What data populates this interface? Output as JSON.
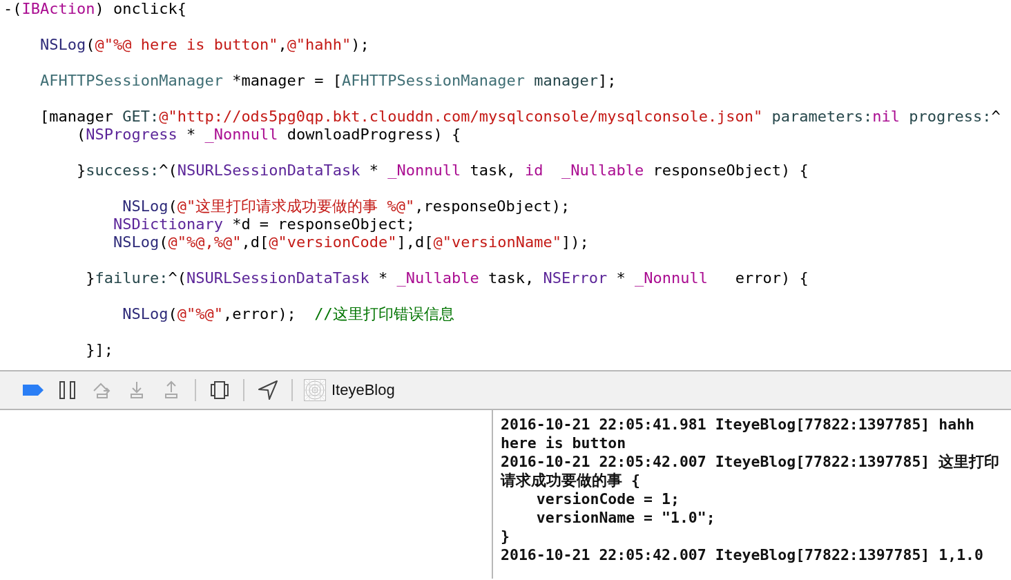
{
  "editor": {
    "lines": [
      {
        "kind": "code",
        "tokens": [
          {
            "kind": "plain",
            "text": "-("
          },
          {
            "kind": "keyword",
            "text": "IBAction"
          },
          {
            "kind": "plain",
            "text": ") onclick{"
          }
        ]
      },
      {
        "kind": "blank"
      },
      {
        "kind": "code",
        "tokens": [
          {
            "kind": "function",
            "text": "    NSLog"
          },
          {
            "kind": "plain",
            "text": "("
          },
          {
            "kind": "string",
            "text": "@\"%@ here is button\""
          },
          {
            "kind": "plain",
            "text": ","
          },
          {
            "kind": "string",
            "text": "@\"hahh\""
          },
          {
            "kind": "plain",
            "text": ");"
          }
        ]
      },
      {
        "kind": "blank"
      },
      {
        "kind": "code",
        "tokens": [
          {
            "kind": "project",
            "text": "    AFHTTPSessionManager"
          },
          {
            "kind": "plain",
            "text": " *manager = ["
          },
          {
            "kind": "project",
            "text": "AFHTTPSessionManager"
          },
          {
            "kind": "method",
            "text": " manager"
          },
          {
            "kind": "plain",
            "text": "];"
          }
        ]
      },
      {
        "kind": "blank"
      },
      {
        "kind": "code",
        "tokens": [
          {
            "kind": "plain",
            "text": "    [manager "
          },
          {
            "kind": "method",
            "text": "GET:"
          },
          {
            "kind": "string",
            "text": "@\"http://ods5pg0qp.bkt.clouddn.com/mysqlconsole/mysqlconsole.json\""
          },
          {
            "kind": "method",
            "text": " parameters:"
          },
          {
            "kind": "keyword",
            "text": "nil"
          },
          {
            "kind": "method",
            "text": " progress:"
          },
          {
            "kind": "plain",
            "text": "^"
          }
        ]
      },
      {
        "kind": "code",
        "tokens": [
          {
            "kind": "plain",
            "text": "        ("
          },
          {
            "kind": "type",
            "text": "NSProgress"
          },
          {
            "kind": "plain",
            "text": " * "
          },
          {
            "kind": "keyword",
            "text": "_Nonnull"
          },
          {
            "kind": "plain",
            "text": " downloadProgress) {"
          }
        ]
      },
      {
        "kind": "blank"
      },
      {
        "kind": "code",
        "tokens": [
          {
            "kind": "plain",
            "text": "        }"
          },
          {
            "kind": "method",
            "text": "success:"
          },
          {
            "kind": "plain",
            "text": "^("
          },
          {
            "kind": "type",
            "text": "NSURLSessionDataTask"
          },
          {
            "kind": "plain",
            "text": " * "
          },
          {
            "kind": "keyword",
            "text": "_Nonnull"
          },
          {
            "kind": "plain",
            "text": " task, "
          },
          {
            "kind": "keyword",
            "text": "id"
          },
          {
            "kind": "keyword",
            "text": "  _Nullable"
          },
          {
            "kind": "plain",
            "text": " responseObject) {"
          }
        ]
      },
      {
        "kind": "blank"
      },
      {
        "kind": "code",
        "tokens": [
          {
            "kind": "function",
            "text": "             NSLog"
          },
          {
            "kind": "plain",
            "text": "("
          },
          {
            "kind": "string",
            "text": "@\"这里打印请求成功要做的事 %@\""
          },
          {
            "kind": "plain",
            "text": ",responseObject);"
          }
        ]
      },
      {
        "kind": "code",
        "tokens": [
          {
            "kind": "type",
            "text": "            NSDictionary"
          },
          {
            "kind": "plain",
            "text": " *d = responseObject;"
          }
        ]
      },
      {
        "kind": "code",
        "tokens": [
          {
            "kind": "function",
            "text": "            NSLog"
          },
          {
            "kind": "plain",
            "text": "("
          },
          {
            "kind": "string",
            "text": "@\"%@,%@\""
          },
          {
            "kind": "plain",
            "text": ",d["
          },
          {
            "kind": "string",
            "text": "@\"versionCode\""
          },
          {
            "kind": "plain",
            "text": "],d["
          },
          {
            "kind": "string",
            "text": "@\"versionName\""
          },
          {
            "kind": "plain",
            "text": "]);"
          }
        ]
      },
      {
        "kind": "blank"
      },
      {
        "kind": "code",
        "tokens": [
          {
            "kind": "plain",
            "text": "         }"
          },
          {
            "kind": "method",
            "text": "failure:"
          },
          {
            "kind": "plain",
            "text": "^("
          },
          {
            "kind": "type",
            "text": "NSURLSessionDataTask"
          },
          {
            "kind": "plain",
            "text": " * "
          },
          {
            "kind": "keyword",
            "text": "_Nullable"
          },
          {
            "kind": "plain",
            "text": " task, "
          },
          {
            "kind": "type",
            "text": "NSError"
          },
          {
            "kind": "plain",
            "text": " * "
          },
          {
            "kind": "keyword",
            "text": "_Nonnull"
          },
          {
            "kind": "plain",
            "text": "   error) {"
          }
        ]
      },
      {
        "kind": "blank"
      },
      {
        "kind": "code",
        "tokens": [
          {
            "kind": "function",
            "text": "             NSLog"
          },
          {
            "kind": "plain",
            "text": "("
          },
          {
            "kind": "string",
            "text": "@\"%@\""
          },
          {
            "kind": "plain",
            "text": ",error);  "
          },
          {
            "kind": "comment",
            "text": "//这里打印错误信息"
          }
        ]
      },
      {
        "kind": "blank"
      },
      {
        "kind": "code",
        "tokens": [
          {
            "kind": "plain",
            "text": "         }];"
          }
        ]
      }
    ]
  },
  "debug_bar": {
    "items": [
      {
        "kind": "breakpoints",
        "disabled": false
      },
      {
        "kind": "pause",
        "disabled": false
      },
      {
        "kind": "step-over",
        "disabled": true
      },
      {
        "kind": "step-into",
        "disabled": true
      },
      {
        "kind": "step-out",
        "disabled": true
      },
      {
        "kind": "separator"
      },
      {
        "kind": "view-debugger",
        "disabled": false
      },
      {
        "kind": "separator"
      },
      {
        "kind": "location",
        "disabled": false
      },
      {
        "kind": "separator"
      }
    ],
    "target": "IteyeBlog"
  },
  "console": {
    "lines": [
      "2016-10-21 22:05:41.981 IteyeBlog[77822:1397785] hahh",
      "here is button",
      "2016-10-21 22:05:42.007 IteyeBlog[77822:1397785] 这里打印",
      "请求成功要做的事 {",
      "    versionCode = 1;",
      "    versionName = \"1.0\";",
      "}",
      "2016-10-21 22:05:42.007 IteyeBlog[77822:1397785] 1,1.0"
    ]
  }
}
